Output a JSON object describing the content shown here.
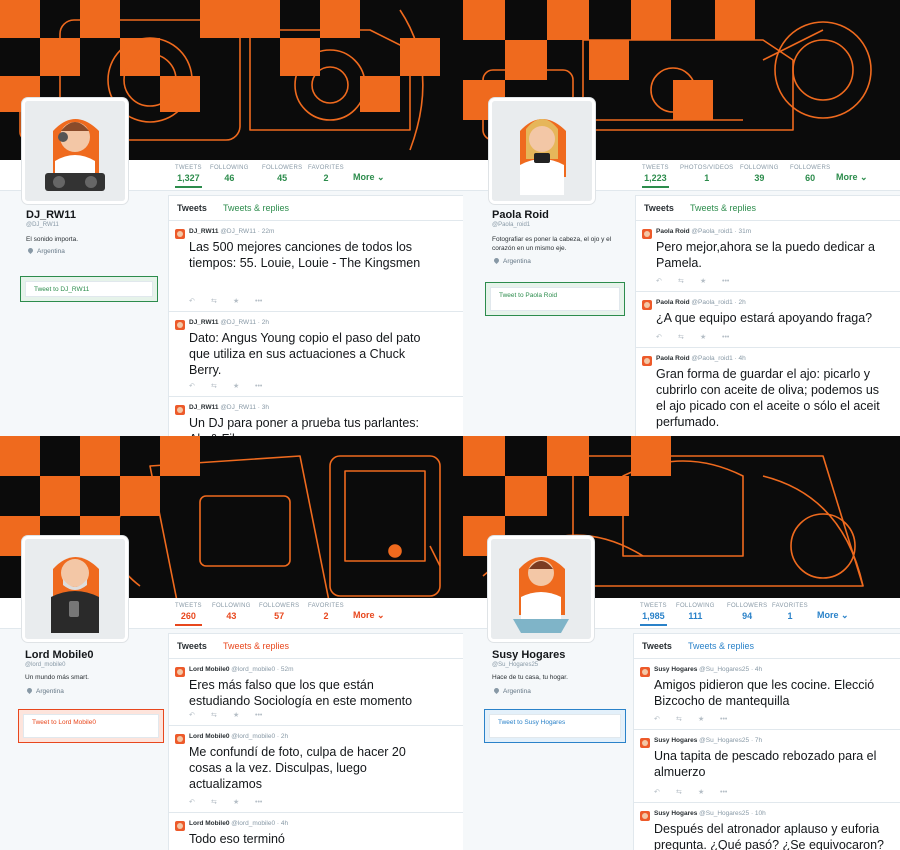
{
  "profiles": [
    {
      "accent": "#2c8c4c",
      "name": "DJ_RW11",
      "handle": "@DJ_RW11",
      "bio": "El sonido importa.",
      "location": "Argentina",
      "tweet_to": "Tweet to DJ_RW11",
      "avatar_icon": "dj-avatar-icon",
      "banner_icon": "camera-banner-icon",
      "stats": [
        {
          "label": "TWEETS",
          "value": "1,327",
          "active": true
        },
        {
          "label": "FOLLOWING",
          "value": "46"
        },
        {
          "label": "FOLLOWERS",
          "value": "45"
        },
        {
          "label": "FAVORITES",
          "value": "2"
        }
      ],
      "more": "More",
      "tabs": [
        "Tweets",
        "Tweets & replies"
      ],
      "tweets": [
        {
          "name": "DJ_RW11",
          "handle": "@DJ_RW11",
          "time": "22m",
          "text": "Las 500 mejores canciones de todos los\ntiempos: 55. Louie, Louie - The Kingsmen"
        },
        {
          "name": "DJ_RW11",
          "handle": "@DJ_RW11",
          "time": "2h",
          "text": "Dato:  Angus Young copio el paso del pato\nque utiliza en sus actuaciones a Chuck\nBerry."
        },
        {
          "name": "DJ_RW11",
          "handle": "@DJ_RW11",
          "time": "3h",
          "text": "Un DJ para poner a prueba tus parlantes:\nAly & Fila"
        }
      ]
    },
    {
      "accent": "#2c8c4c",
      "name": "Paola Roid",
      "handle": "@Paola_roid1",
      "bio": "Fotografiar es poner la cabeza, el ojo y el corazón en un mismo eje.",
      "location": "Argentina",
      "tweet_to": "Tweet to Paola Roid",
      "avatar_icon": "photographer-avatar-icon",
      "banner_icon": "videocamera-banner-icon",
      "stats": [
        {
          "label": "TWEETS",
          "value": "1,223",
          "active": true
        },
        {
          "label": "PHOTOS/VIDEOS",
          "value": "1"
        },
        {
          "label": "FOLLOWING",
          "value": "39"
        },
        {
          "label": "FOLLOWERS",
          "value": "60"
        }
      ],
      "more": "More",
      "tabs": [
        "Tweets",
        "Tweets & replies"
      ],
      "tweets": [
        {
          "name": "Paola Roid",
          "handle": "@Paola_roid1",
          "time": "31m",
          "text": "Pero mejor,ahora se la puedo dedicar a\nPamela."
        },
        {
          "name": "Paola Roid",
          "handle": "@Paola_roid1",
          "time": "2h",
          "text": "¿A que equipo estará apoyando fraga?"
        },
        {
          "name": "Paola Roid",
          "handle": "@Paola_roid1",
          "time": "4h",
          "text": "Gran forma de guardar el ajo: picarlo y\ncubrirlo con aceite de oliva; podemos us\nel ajo picado con el aceite o sólo el aceit\nperfumado."
        }
      ]
    },
    {
      "accent": "#e8471d",
      "name": "Lord Mobile0",
      "handle": "@lord_mobile0",
      "bio": "Un mundo más smart.",
      "location": "Argentina",
      "tweet_to": "Tweet to Lord Mobile0",
      "avatar_icon": "old-man-avatar-icon",
      "banner_icon": "smartphone-banner-icon",
      "stats": [
        {
          "label": "TWEETS",
          "value": "260",
          "active": true
        },
        {
          "label": "FOLLOWING",
          "value": "43"
        },
        {
          "label": "FOLLOWERS",
          "value": "57"
        },
        {
          "label": "FAVORITES",
          "value": "2"
        }
      ],
      "more": "More",
      "tabs": [
        "Tweets",
        "Tweets & replies"
      ],
      "tweets": [
        {
          "name": "Lord Mobile0",
          "handle": "@lord_mobile0",
          "time": "52m",
          "text": "Eres más falso que los que están\nestudiando Sociología en este momento"
        },
        {
          "name": "Lord Mobile0",
          "handle": "@lord_mobile0",
          "time": "2h",
          "text": "Me confundí de foto, culpa de hacer 20\ncosas a la vez. Disculpas, luego\nactualizamos"
        },
        {
          "name": "Lord Mobile0",
          "handle": "@lord_mobile0",
          "time": "4h",
          "text": "Todo eso terminó"
        }
      ]
    },
    {
      "accent": "#2a82c9",
      "name": "Susy Hogares",
      "handle": "@Su_Hogares25",
      "bio": "Hace de tu casa, tu hogar.",
      "location": "Argentina",
      "tweet_to": "Tweet to Susy Hogares",
      "avatar_icon": "housewife-avatar-icon",
      "banner_icon": "iron-banner-icon",
      "stats": [
        {
          "label": "TWEETS",
          "value": "1,985",
          "active": true
        },
        {
          "label": "FOLLOWING",
          "value": "111"
        },
        {
          "label": "FOLLOWERS",
          "value": "94"
        },
        {
          "label": "FAVORITES",
          "value": "1"
        }
      ],
      "more": "More",
      "tabs": [
        "Tweets",
        "Tweets & replies"
      ],
      "tweets": [
        {
          "name": "Susy Hogares",
          "handle": "@Su_Hogares25",
          "time": "4h",
          "text": "Amigos pidieron que les cocine. Elecció\nBizcocho de mantequilla"
        },
        {
          "name": "Susy Hogares",
          "handle": "@Su_Hogares25",
          "time": "7h",
          "text": "Una tapita de pescado rebozado para el\nalmuerzo"
        },
        {
          "name": "Susy Hogares",
          "handle": "@Su_Hogares25",
          "time": "10h",
          "text": "Después del atronador aplauso y euforia\npregunta. ¿Qué pasó? ¿Se equivocaron?"
        }
      ]
    }
  ]
}
